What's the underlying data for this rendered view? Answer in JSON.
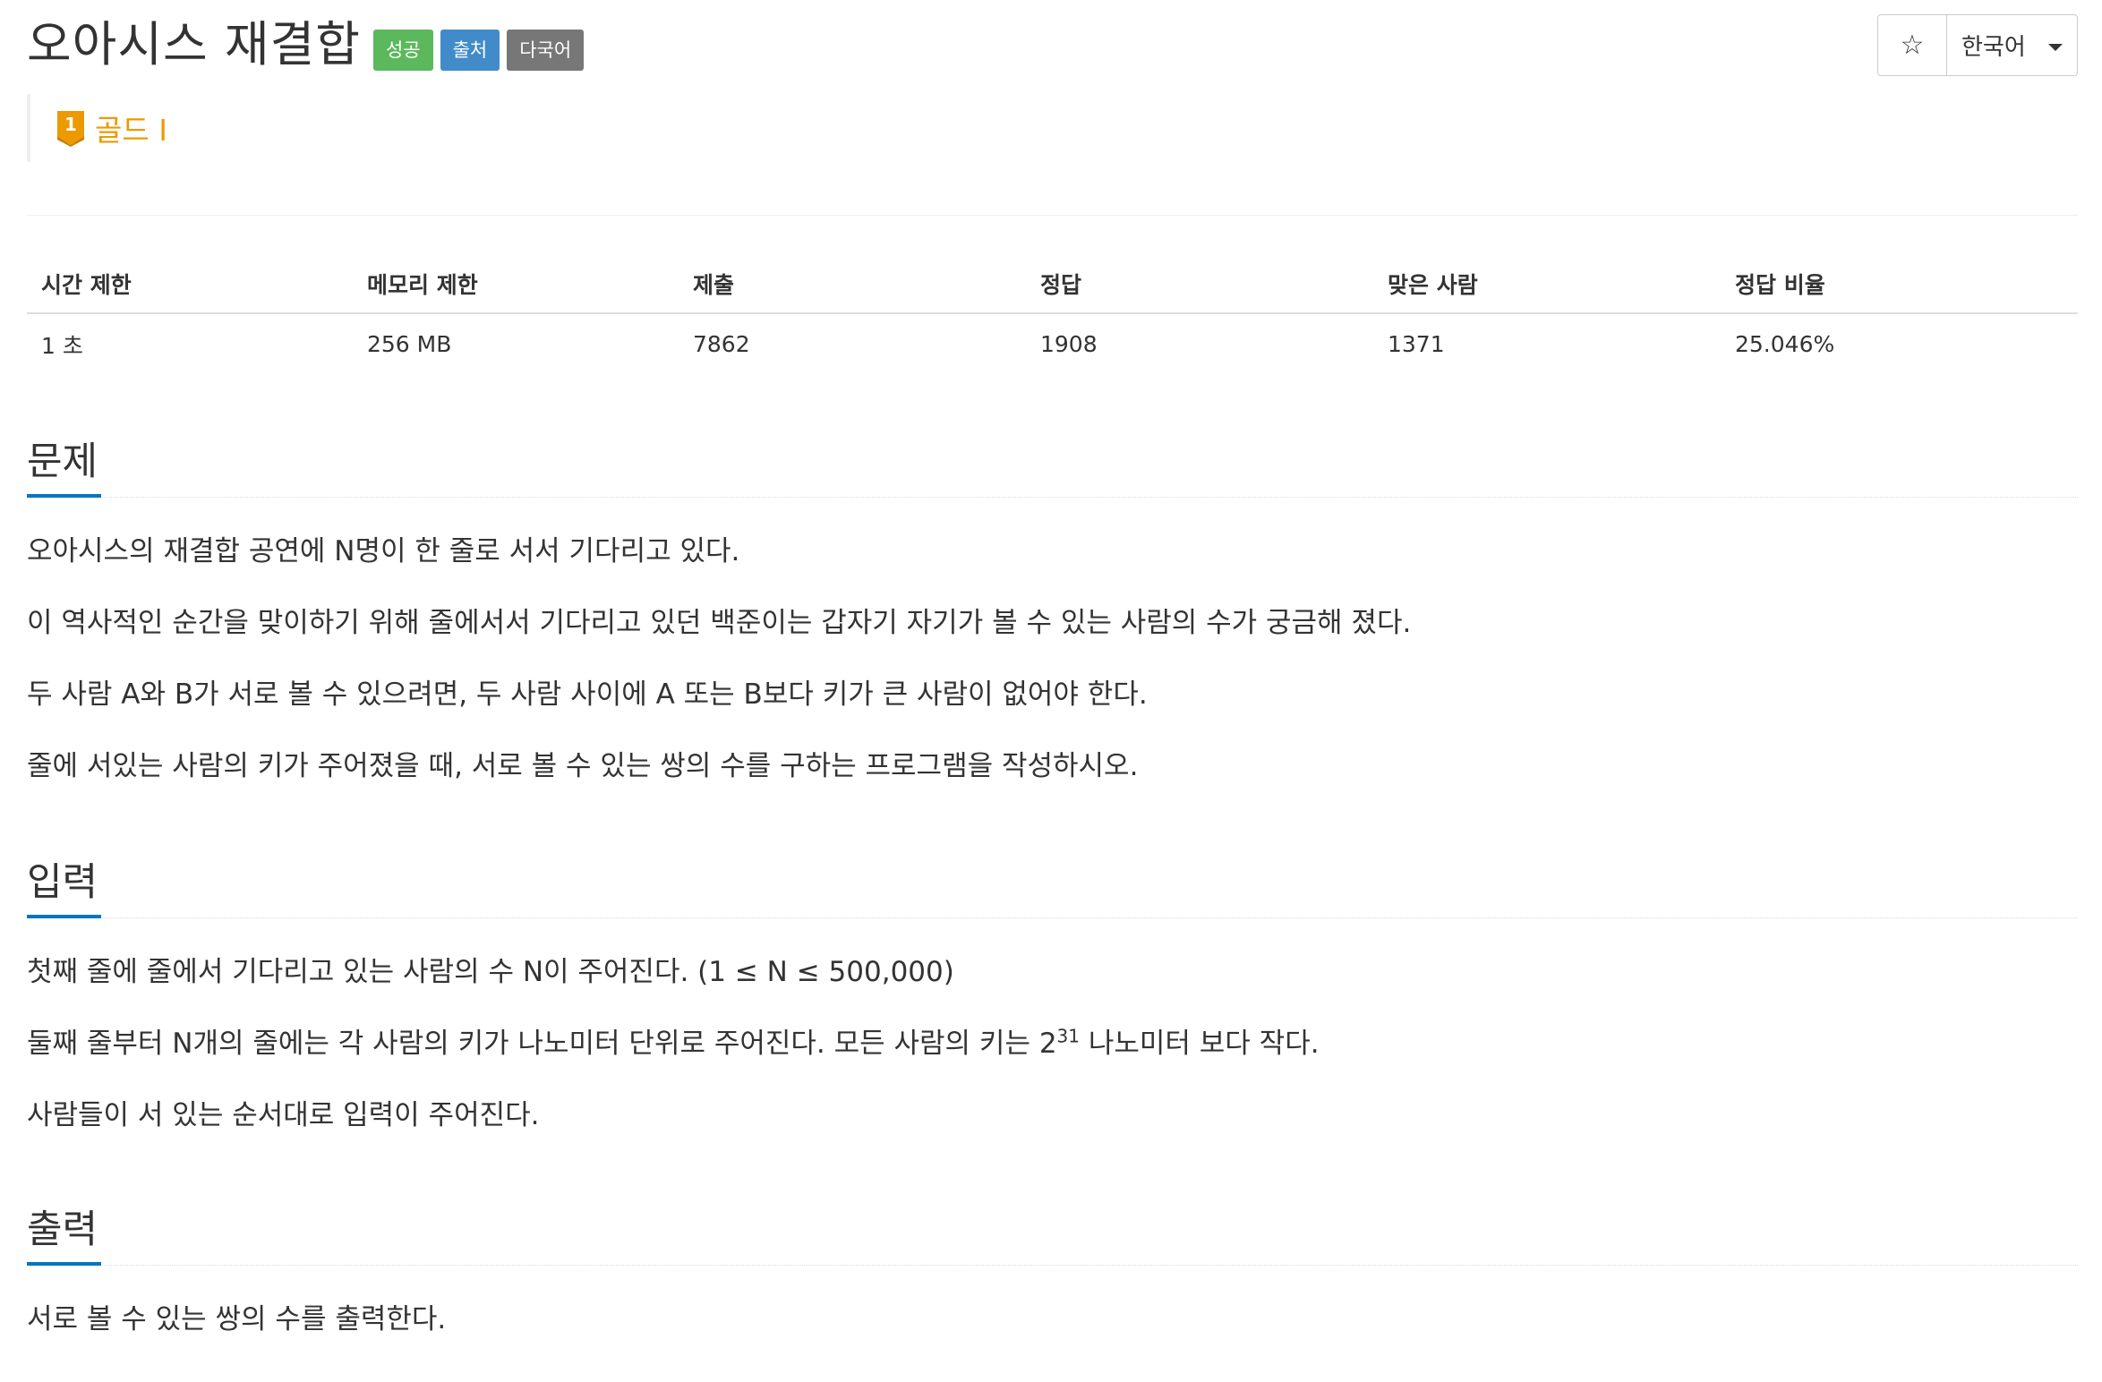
{
  "header": {
    "title": "오아시스 재결합",
    "labels": {
      "success": "성공",
      "source": "출처",
      "multilang": "다국어"
    },
    "star": "☆",
    "language": "한국어",
    "tier": {
      "badge_number": "1",
      "text": "골드 I"
    }
  },
  "colors": {
    "tier_gold": "#ec9a00",
    "section_underline": "#0076c0",
    "label_success": "#5cb85c",
    "label_primary": "#428bca",
    "label_default": "#777777"
  },
  "stats": {
    "headers": [
      "시간 제한",
      "메모리 제한",
      "제출",
      "정답",
      "맞은 사람",
      "정답 비율"
    ],
    "values": [
      "1 초",
      "256 MB",
      "7862",
      "1908",
      "1371",
      "25.046%"
    ]
  },
  "problem": {
    "heading": "문제",
    "paragraphs": [
      "오아시스의 재결합 공연에 N명이 한 줄로 서서 기다리고 있다.",
      "이 역사적인 순간을 맞이하기 위해 줄에서서 기다리고 있던 백준이는 갑자기 자기가 볼 수 있는 사람의 수가 궁금해 졌다.",
      "두 사람 A와 B가 서로 볼 수 있으려면, 두 사람 사이에 A 또는 B보다 키가 큰 사람이 없어야 한다.",
      "줄에 서있는 사람의 키가 주어졌을 때, 서로 볼 수 있는 쌍의 수를 구하는 프로그램을 작성하시오."
    ]
  },
  "input": {
    "heading": "입력",
    "line1": "첫째 줄에 줄에서 기다리고 있는 사람의 수 N이 주어진다. (1 ≤ N ≤ 500,000)",
    "line2_pre": "둘째 줄부터 N개의 줄에는 각 사람의 키가 나노미터 단위로 주어진다. 모든 사람의 키는 2",
    "line2_sup": "31",
    "line2_post": " 나노미터 보다 작다.",
    "line3": "사람들이 서 있는 순서대로 입력이 주어진다."
  },
  "output": {
    "heading": "출력",
    "line1": "서로 볼 수 있는 쌍의 수를 출력한다."
  }
}
